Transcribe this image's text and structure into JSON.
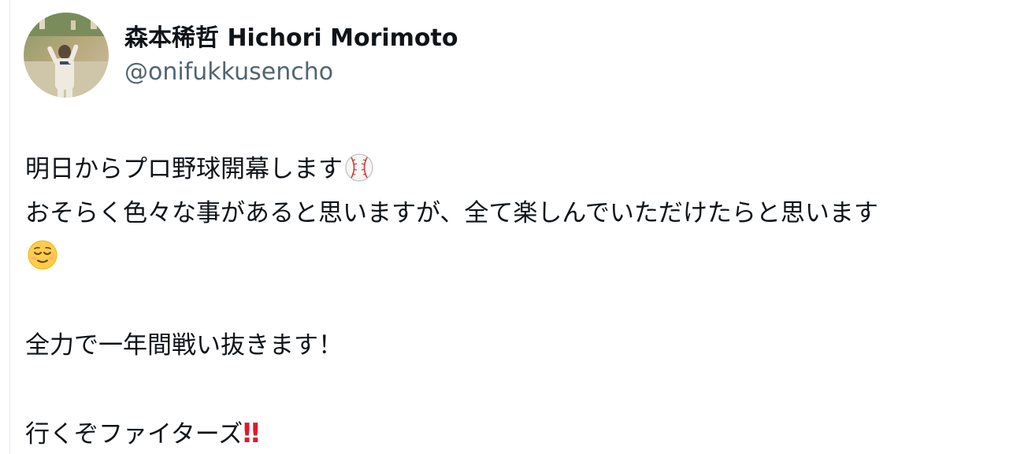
{
  "author": {
    "display_name": "森本稀哲 Hichori Morimoto",
    "handle": "@onifukkusencho",
    "avatar_icon": "user-avatar-photo"
  },
  "tweet": {
    "line1_text": "明日からプロ野球開幕します",
    "line1_emoji": "baseball-emoji",
    "line2_text": "おそらく色々な事があると思いますが、全て楽しんでいただけたらと思います",
    "line3_emoji": "relieved-face-emoji",
    "line5_text": "全力で一年間戦い抜きます！",
    "line7_text": "行くぞファイターズ",
    "line7_emoji": "double-exclamation-emoji",
    "line7_emoji_glyph": "‼"
  },
  "colors": {
    "text": "#0f1419",
    "secondary_text": "#536471",
    "border": "#e6e9ec",
    "exclamation_red": "#e0182b"
  }
}
